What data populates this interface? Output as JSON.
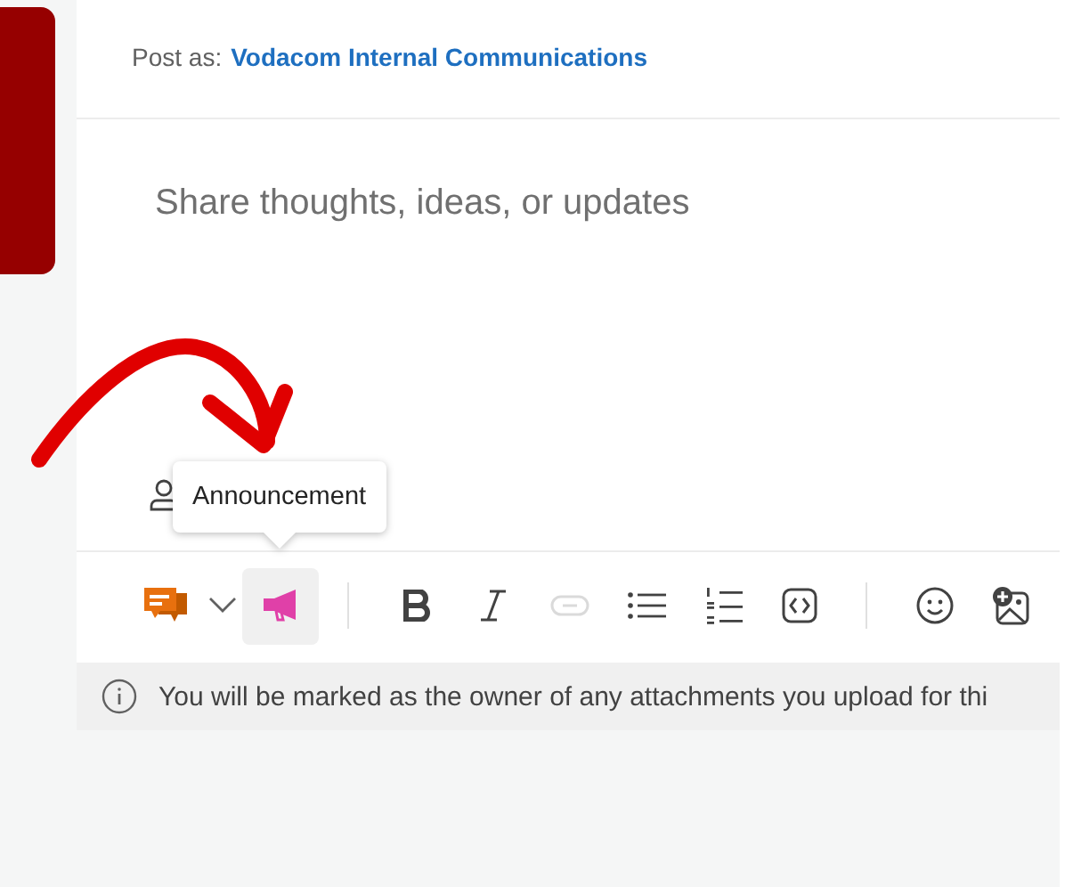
{
  "post_as": {
    "label": "Post as:",
    "name": "Vodacom Internal Communications"
  },
  "message": {
    "placeholder": "Share thoughts, ideas, or updates"
  },
  "tooltip": {
    "text": "Announcement"
  },
  "toolbar": {
    "groups": [
      [
        {
          "kind": "post-type",
          "selected": false,
          "disabled": false
        },
        {
          "kind": "dropdown",
          "selected": false,
          "disabled": false
        },
        {
          "kind": "announcement",
          "selected": true,
          "disabled": false
        }
      ],
      [
        {
          "kind": "bold",
          "selected": false,
          "disabled": false
        },
        {
          "kind": "italic",
          "selected": false,
          "disabled": false
        },
        {
          "kind": "link",
          "selected": false,
          "disabled": true
        },
        {
          "kind": "bullets",
          "selected": false,
          "disabled": false
        },
        {
          "kind": "numbering",
          "selected": false,
          "disabled": false
        },
        {
          "kind": "code",
          "selected": false,
          "disabled": false
        }
      ],
      [
        {
          "kind": "emoji",
          "selected": false,
          "disabled": false
        },
        {
          "kind": "image",
          "selected": false,
          "disabled": false
        }
      ]
    ]
  },
  "notice": {
    "text": "You will be marked as the owner of any attachments you upload for thi"
  }
}
